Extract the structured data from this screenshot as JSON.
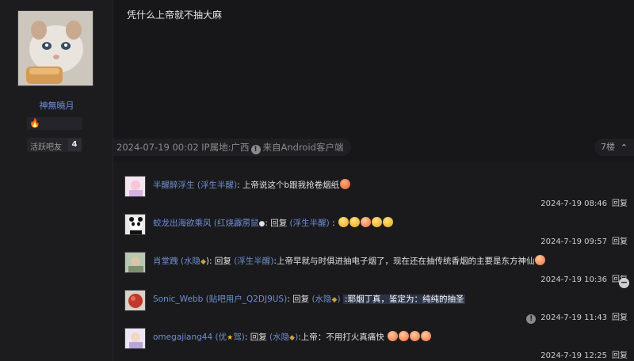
{
  "author": {
    "name": "神無曉月",
    "badge_icon": "fire-icon",
    "fans_label": "活跃吧友",
    "fans_level": "4"
  },
  "post": {
    "text": "凭什么上帝就不抽大麻",
    "meta": "2024-07-19 00:02 IP属地:广西",
    "source": "来自Android客户端",
    "floor": "7楼"
  },
  "replies": [
    {
      "user": "半醒醉浮生",
      "tag": "(浮生半醒)",
      "sep": ":",
      "text": "上帝说这个b跟我抢卷烟纸",
      "time": "2024-7-19 08:46",
      "reply_btn": "回复"
    },
    {
      "user": "蛟龙出海欲乘风",
      "tag": "(红烧霹雳鼠",
      "sep": ":",
      "reply_word": "回复",
      "reply_to": "(浮生半醒)",
      "text": ":",
      "time": "2024-7-19 09:57",
      "reply_btn": "回复"
    },
    {
      "user": "肖堂跩",
      "tag": "(水隐",
      "sep": "):",
      "reply_word": "回复",
      "reply_to": "(浮生半醒)",
      "text": ":上帝早就与时俱进抽电子烟了，现在还在抽传统香烟的主要是东方神仙",
      "time": "2024-7-19 10:36",
      "reply_btn": "回复"
    },
    {
      "user": "Sonic_Webb",
      "tag": "(贴吧用户_Q2DJ9US)",
      "sep": ":",
      "reply_word": "回复",
      "reply_to": "(水隐",
      "text": ":耶烟丁真，鉴定为：纯纯的抽圣",
      "time": "2024-7-19 11:43",
      "reply_btn": "回复"
    },
    {
      "user": "omegajiang44",
      "tag": "(优",
      "tag2": "驾)",
      "sep": ":",
      "reply_word": "回复",
      "reply_to": "(水隐",
      "text": ":上帝：不用打火真痛快",
      "time": "2024-7-19 12:25",
      "reply_btn": "回复"
    }
  ],
  "colors": {
    "background": "#17171a",
    "username": "#6f8fd0",
    "highlight": "#2b3347"
  }
}
